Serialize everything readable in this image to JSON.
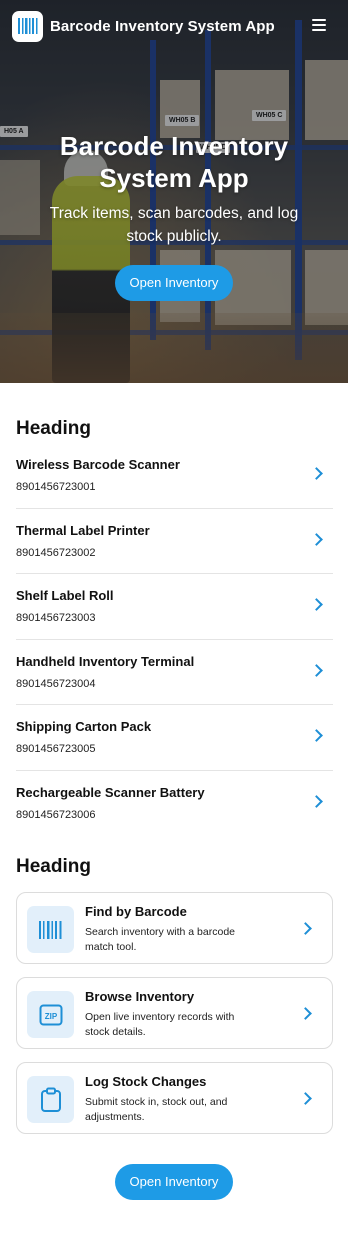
{
  "app": {
    "title": "Barcode Inventory System App"
  },
  "hero": {
    "title": "Barcode Inventory System App",
    "subtitle": "Track items, scan barcodes, and log stock publicly.",
    "cta_label": "Open Inventory",
    "signs": [
      "WH05 B",
      "WH05 C",
      "WH05 D",
      "H05 A"
    ]
  },
  "items_section": {
    "heading": "Heading",
    "items": [
      {
        "name": "Wireless Barcode Scanner",
        "code": "8901456723001"
      },
      {
        "name": "Thermal Label Printer",
        "code": "8901456723002"
      },
      {
        "name": "Shelf Label Roll",
        "code": "8901456723003"
      },
      {
        "name": "Handheld Inventory Terminal",
        "code": "8901456723004"
      },
      {
        "name": "Shipping Carton Pack",
        "code": "8901456723005"
      },
      {
        "name": "Rechargeable Scanner Battery",
        "code": "8901456723006"
      }
    ]
  },
  "features_section": {
    "heading": "Heading",
    "cards": [
      {
        "title": "Find by Barcode",
        "description": "Search inventory with a barcode match tool.",
        "icon": "barcode-icon"
      },
      {
        "title": "Browse Inventory",
        "description": "Open live inventory records with stock details.",
        "icon": "zip-icon",
        "icon_text": "ZIP"
      },
      {
        "title": "Log Stock Changes",
        "description": "Submit stock in, stock out, and adjustments.",
        "icon": "clipboard-icon"
      }
    ]
  },
  "footer": {
    "cta_label": "Open Inventory"
  },
  "colors": {
    "accent": "#1e9be6",
    "icon_bg": "#e2effa",
    "icon_stroke": "#1e8fd6"
  }
}
